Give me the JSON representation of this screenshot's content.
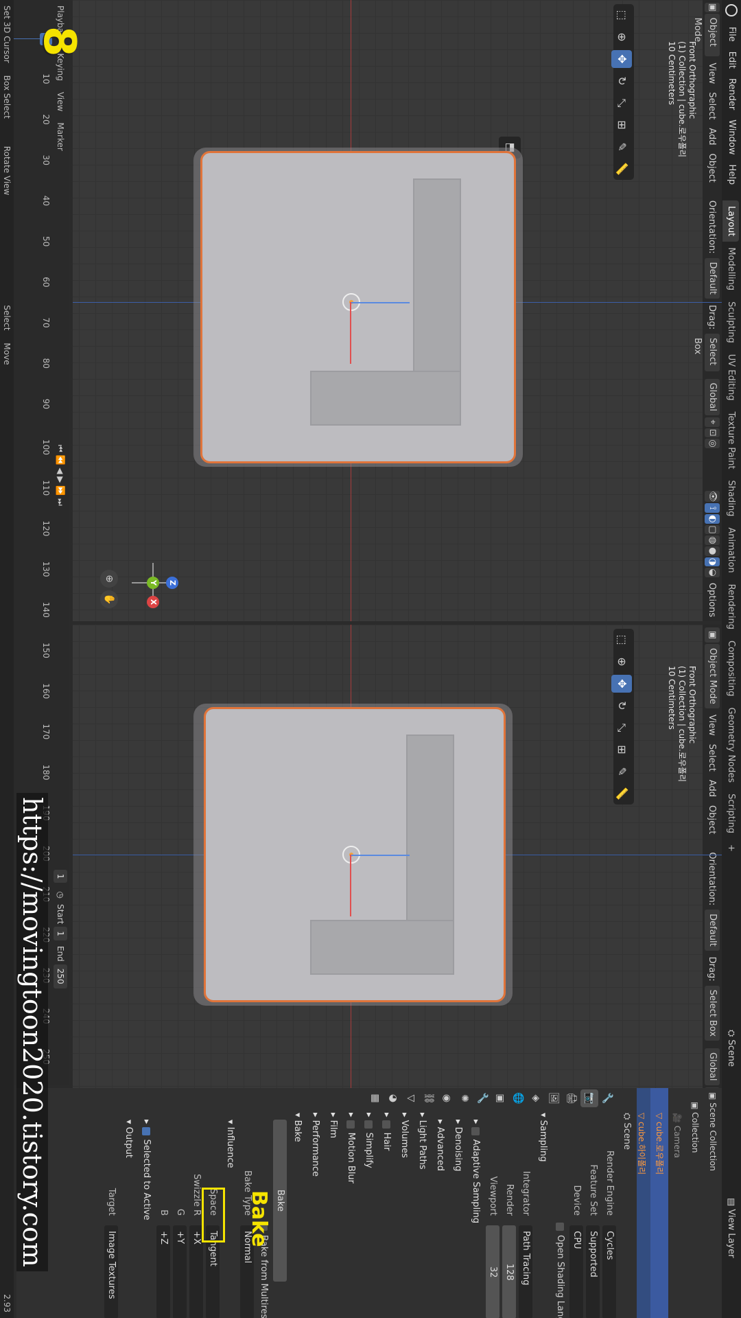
{
  "menu": {
    "items": [
      "File",
      "Edit",
      "Render",
      "Window",
      "Help"
    ],
    "workspaces": [
      "Layout",
      "Modelling",
      "Sculpting",
      "UV Editing",
      "Texture Paint",
      "Shading",
      "Animation",
      "Rendering",
      "Compositing",
      "Geometry Nodes",
      "Scripting"
    ],
    "add_tab": "+",
    "scene": "Scene",
    "view_layer": "View Layer"
  },
  "viewport_header": {
    "mode": "Object Mode",
    "view": "View",
    "select": "Select",
    "add": "Add",
    "object": "Object",
    "orientation_label": "Orientation:",
    "orientation": "Default",
    "drag_label": "Drag:",
    "drag": "Select Box",
    "transform": "Global",
    "options": "Options"
  },
  "viewport_left": {
    "view_name": "Front Orthographic",
    "collection_line": "(1) Collection | cube.로우폴리",
    "scale": "10 Centimeters"
  },
  "viewport_right": {
    "view_name": "Front Orthographic",
    "collection_line": "(1) Collection | cube.로우폴리",
    "scale": "10 Centimeters"
  },
  "timeline": {
    "menu": [
      "Playback",
      "Keying",
      "View",
      "Marker"
    ],
    "ticks": [
      "10",
      "20",
      "30",
      "40",
      "50",
      "60",
      "70",
      "80",
      "90",
      "100",
      "110",
      "120",
      "130",
      "140",
      "150",
      "160",
      "170",
      "180",
      "190",
      "200",
      "210",
      "220",
      "230",
      "240",
      "250"
    ],
    "current_frame": "1",
    "frame_field": "1",
    "start_label": "Start",
    "start": "1",
    "end_label": "End",
    "end": "250"
  },
  "outliner": {
    "root": "Scene Collection",
    "collection": "Collection",
    "items": [
      {
        "name": "Camera"
      },
      {
        "name": "cube.로우폴리"
      },
      {
        "name": "cube.하이폴리"
      }
    ]
  },
  "properties": {
    "header": "Scene",
    "render_engine_label": "Render Engine",
    "render_engine": "Cycles",
    "feature_set_label": "Feature Set",
    "feature_set": "Supported",
    "device_label": "Device",
    "device": "CPU",
    "osl": "Open Shading Language",
    "sampling": "Sampling",
    "integrator_label": "Integrator",
    "integrator": "Path Tracing",
    "render_label": "Render",
    "render_value": "128",
    "viewport_label": "Viewport",
    "viewport_value": "32",
    "adaptive_sampling": "Adaptive Sampling",
    "denoising": "Denoising",
    "advanced": "Advanced",
    "light_paths": "Light Paths",
    "volumes": "Volumes",
    "hair": "Hair",
    "simplify": "Simplify",
    "motion_blur": "Motion Blur",
    "film": "Film",
    "performance": "Performance",
    "bake_section": "Bake",
    "bake_button": "Bake",
    "bake_from_multires": "Bake from Multires",
    "bake_type_label": "Bake Type",
    "bake_type": "Normal",
    "influence": "Influence",
    "space_label": "Space",
    "space": "Tangent",
    "swizzle_r_label": "Swizzle R",
    "swizzle_r": "+X",
    "g_label": "G",
    "g": "+Y",
    "b_label": "B",
    "b": "+Z",
    "selected_to_active": "Selected to Active",
    "output": "Output",
    "target_label": "Target",
    "target": "Image Textures"
  },
  "annotation": {
    "step_number": "8",
    "bake_callout": "Bake",
    "watermark": "https://movingtoon2020.tistory.com",
    "accent": "#f5e300"
  },
  "statusbar": {
    "items": [
      "Set 3D Cursor",
      "Box Select",
      "Rotate View",
      "Select",
      "Move"
    ],
    "version": "2.93"
  },
  "colors": {
    "selection_outline": "#e0743a",
    "active_blue": "#4772b3",
    "axis_x": "#a83b3b",
    "axis_z": "#3c5fa8"
  }
}
